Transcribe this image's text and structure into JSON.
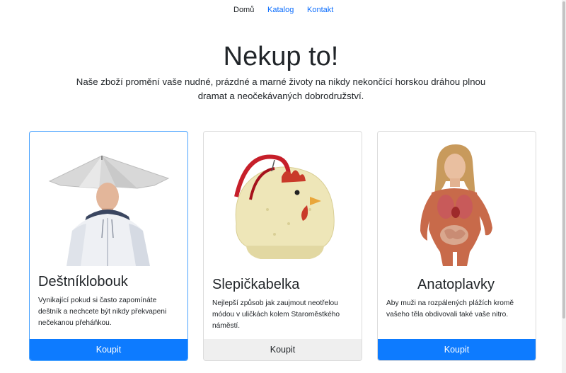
{
  "nav": {
    "items": [
      {
        "label": "Domů",
        "active": true
      },
      {
        "label": "Katalog",
        "active": false
      },
      {
        "label": "Kontakt",
        "active": false
      }
    ]
  },
  "hero": {
    "title": "Nekup to!",
    "description": "Naše zboží promění vaše nudné, prázdné a marné životy na nikdy nekončící horskou dráhou plnou dramat a neočekávaných dobrodružství."
  },
  "products": [
    {
      "title": "Deštníklobouk",
      "text": "Vynikající pokud si často zapomínáte deštník a nechcete být nikdy překvapeni nečekanou přeháňkou.",
      "button": "Koupit",
      "button_style": "primary",
      "image_icon": "umbrella-hat-image"
    },
    {
      "title": "Slepičkabelka",
      "text": "Nejlepší způsob jak zaujmout neotřelou módou v uličkách kolem Staroměstkého náměstí.",
      "button": "Koupit",
      "button_style": "secondary",
      "image_icon": "chicken-bag-image"
    },
    {
      "title": "Anatoplavky",
      "text": "Aby muži na rozpálených plážích kromě vašeho těla obdivovali také vaše nitro.",
      "button": "Koupit",
      "button_style": "primary",
      "image_icon": "anatomy-swimsuit-image"
    }
  ],
  "colors": {
    "primary": "#0d7bff",
    "link": "#0d6efd",
    "secondary": "#efefef",
    "selected_border": "#4aa3ff"
  }
}
